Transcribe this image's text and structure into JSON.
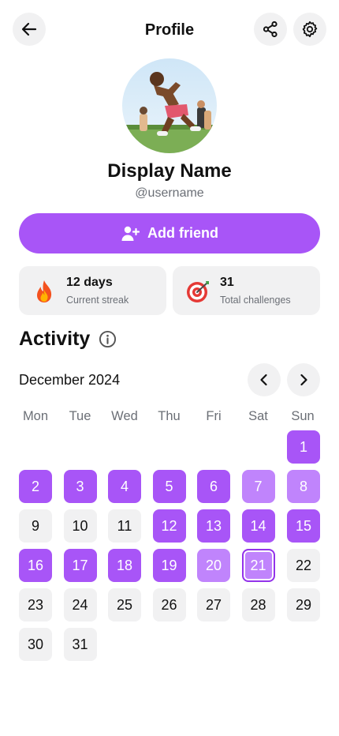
{
  "header": {
    "title": "Profile",
    "back_icon": "arrow-left-icon",
    "share_icon": "share-icon",
    "settings_icon": "gear-icon"
  },
  "profile": {
    "display_name": "Display Name",
    "username": "@username"
  },
  "actions": {
    "add_friend_label": "Add friend",
    "add_friend_icon": "user-plus-icon"
  },
  "stats": [
    {
      "value": "12 days",
      "label": "Current streak",
      "icon": "fire-icon"
    },
    {
      "value": "31",
      "label": "Total challenges",
      "icon": "target-icon"
    }
  ],
  "activity": {
    "title": "Activity",
    "month_label": "December 2024",
    "weekdays": [
      "Mon",
      "Tue",
      "Wed",
      "Thu",
      "Fri",
      "Sat",
      "Sun"
    ],
    "first_weekday_index": 6,
    "days": [
      {
        "day": 1,
        "status": "done"
      },
      {
        "day": 2,
        "status": "done"
      },
      {
        "day": 3,
        "status": "done"
      },
      {
        "day": 4,
        "status": "done"
      },
      {
        "day": 5,
        "status": "done"
      },
      {
        "day": 6,
        "status": "done"
      },
      {
        "day": 7,
        "status": "frozen"
      },
      {
        "day": 8,
        "status": "frozen"
      },
      {
        "day": 9,
        "status": "empty"
      },
      {
        "day": 10,
        "status": "empty"
      },
      {
        "day": 11,
        "status": "empty"
      },
      {
        "day": 12,
        "status": "done"
      },
      {
        "day": 13,
        "status": "done"
      },
      {
        "day": 14,
        "status": "done"
      },
      {
        "day": 15,
        "status": "done"
      },
      {
        "day": 16,
        "status": "done"
      },
      {
        "day": 17,
        "status": "done"
      },
      {
        "day": 18,
        "status": "done"
      },
      {
        "day": 19,
        "status": "done"
      },
      {
        "day": 20,
        "status": "frozen"
      },
      {
        "day": 21,
        "status": "today"
      },
      {
        "day": 22,
        "status": "empty"
      },
      {
        "day": 23,
        "status": "empty"
      },
      {
        "day": 24,
        "status": "empty"
      },
      {
        "day": 25,
        "status": "empty"
      },
      {
        "day": 26,
        "status": "empty"
      },
      {
        "day": 27,
        "status": "empty"
      },
      {
        "day": 28,
        "status": "empty"
      },
      {
        "day": 29,
        "status": "empty"
      },
      {
        "day": 30,
        "status": "empty"
      },
      {
        "day": 31,
        "status": "empty"
      }
    ]
  },
  "colors": {
    "accent": "#a855f7",
    "accent_light": "#c084fc",
    "accent_dark": "#9333ea",
    "chip_bg": "#f1f1f2",
    "muted_text": "#6b6f76"
  }
}
